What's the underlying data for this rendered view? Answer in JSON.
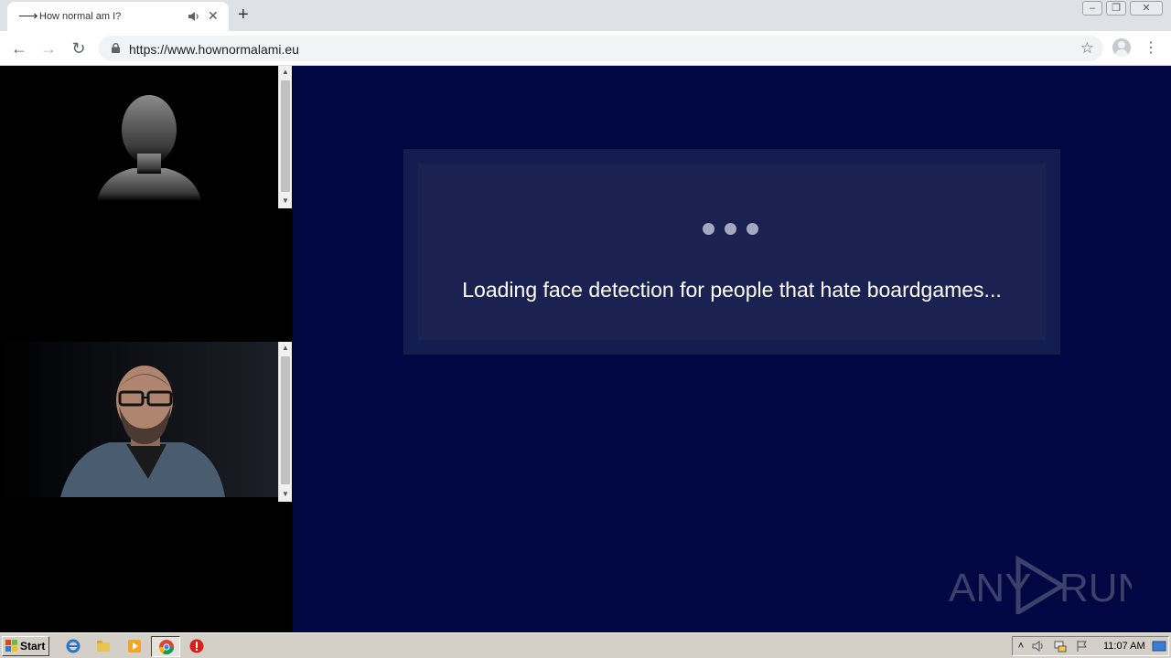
{
  "browser": {
    "tab": {
      "title": "How normal am I?",
      "favicon": "arrow-right-icon",
      "audio_icon": "speaker-icon",
      "close_label": "✕"
    },
    "new_tab_label": "+",
    "window_controls": {
      "minimize": "minimize-icon",
      "restore": "restore-icon",
      "close": "close-icon"
    },
    "toolbar": {
      "back": "←",
      "forward": "→",
      "reload": "↻",
      "url": "https://www.hownormalami.eu",
      "bookmark": "☆",
      "menu": "⋮"
    }
  },
  "page": {
    "loading_text": "Loading face detection for people that hate boardgames...",
    "background_color": "#000742",
    "panel_color": "#1b2252",
    "dot_color": "#a5a8bf"
  },
  "watermark": {
    "text_left": "ANY",
    "text_right": "RUN"
  },
  "taskbar": {
    "start_label": "Start",
    "clock": "11:07 AM"
  }
}
